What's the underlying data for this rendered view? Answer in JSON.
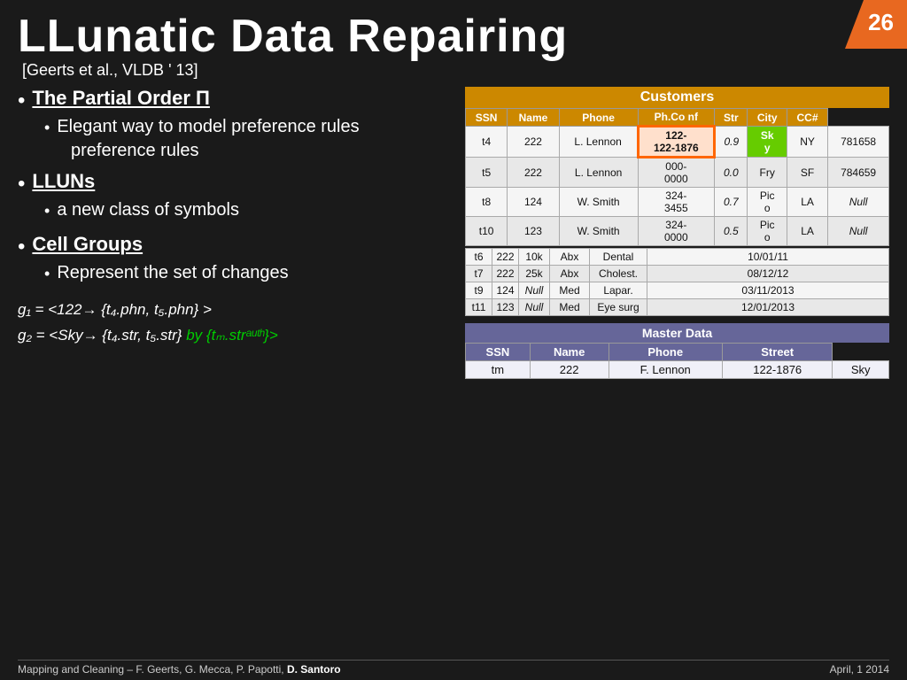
{
  "slide": {
    "number": "26",
    "title": "LLunatic Data Repairing",
    "subtitle": "[Geerts et al., VLDB ' 13]"
  },
  "bullets": [
    {
      "text": "The Partial Order Π",
      "underline": true,
      "sub": [
        {
          "text": "Elegant way to model preference rules"
        }
      ]
    },
    {
      "text": "LLUNs",
      "underline": true,
      "sub": [
        {
          "text": "a new class of symbols"
        }
      ]
    },
    {
      "text": "Cell Groups",
      "underline": true,
      "sub": [
        {
          "text": "Represent the set of changes"
        }
      ]
    }
  ],
  "formulas": {
    "g1": "g₁ = <122→ {t₄.phn, t₅.phn} >",
    "g2_prefix": "g₂ = <Sky→ {t₄.str, t₅.str}",
    "g2_suffix": " by {tₘ.strᵃᵘᵗʰ}>"
  },
  "customers_table": {
    "title": "Customers",
    "headers": [
      "SSN",
      "Name",
      "Phone",
      "Ph.Co nf",
      "Str",
      "City",
      "CC#"
    ],
    "rows": [
      {
        "id": "t4",
        "ssn": "222",
        "name": "L. Lennon",
        "phone": "122-1876",
        "phconf": "0.9",
        "str": "Sk y",
        "city": "NY",
        "cc": "781658",
        "highlight_phone": true,
        "highlight_str": true
      },
      {
        "id": "t5",
        "ssn": "222",
        "name": "L. Lennon",
        "phone": "000-0000",
        "phconf": "0.0",
        "str": "Fry",
        "city": "SF",
        "cc": "784659"
      },
      {
        "id": "t8",
        "ssn": "124",
        "name": "W. Smith",
        "phone": "324-3455",
        "phconf": "0.7",
        "str": "Pic o",
        "city": "LA",
        "cc": "Null",
        "cc_italic": true
      },
      {
        "id": "t10",
        "ssn": "123",
        "name": "W. Smith",
        "phone": "324-0000",
        "phconf": "0.5",
        "str": "Pic o",
        "city": "LA",
        "cc": "Null",
        "cc_italic": true
      }
    ],
    "rows2": [
      {
        "id": "t6",
        "ssn": "222",
        "name": "10k",
        "phone": "Abx",
        "phconf": "Dental",
        "str": "10/01/11"
      },
      {
        "id": "t7",
        "ssn": "222",
        "name": "25k",
        "phone": "Abx",
        "phconf": "Cholest.",
        "str": "08/12/12"
      },
      {
        "id": "t9",
        "ssn": "124",
        "name": "Null",
        "phone": "Med",
        "phconf": "Lapar.",
        "str": "03/11/2013",
        "name_italic": true
      },
      {
        "id": "t11",
        "ssn": "123",
        "name": "Null",
        "phone": "Med",
        "phconf": "Eye surg",
        "str": "12/01/2013",
        "name_italic": true
      }
    ]
  },
  "master_table": {
    "title": "Master Data",
    "headers": [
      "SSN",
      "Name",
      "Phone",
      "Street"
    ],
    "rows": [
      {
        "id": "tm",
        "ssn": "222",
        "name": "F. Lennon",
        "phone": "122-1876",
        "street": "Sky"
      }
    ]
  },
  "footer": {
    "left": "Mapping and Cleaning – F. Geerts, G. Mecca, P. Papotti,",
    "left_bold": " D. Santoro",
    "right": "April, 1 2014"
  }
}
